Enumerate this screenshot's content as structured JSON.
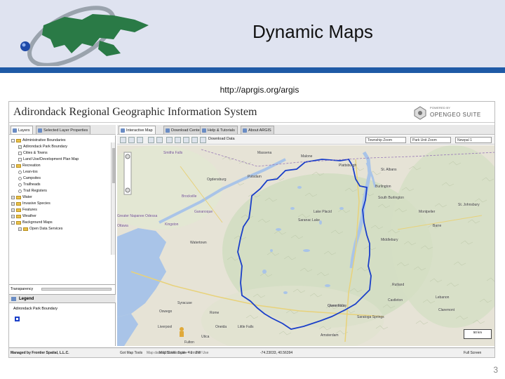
{
  "slide": {
    "title": "Dynamic Maps",
    "url": "http://aprgis.org/argis",
    "page_number": "3"
  },
  "app": {
    "title": "Adirondack Regional Geographic Information System",
    "brand_top": "POWERED BY",
    "brand_name": "OPENGEO SUITE"
  },
  "left_tabs": [
    {
      "label": "Layers",
      "active": true
    },
    {
      "label": "Selected Layer Properties",
      "active": false
    }
  ],
  "right_tabs": [
    {
      "label": "Interactive Map",
      "active": true
    },
    {
      "label": "Download Center",
      "active": false
    },
    {
      "label": "Help & Tutorials",
      "active": false
    },
    {
      "label": "About ARGIS",
      "active": false
    }
  ],
  "layer_tree": [
    {
      "label": "Administrative Boundaries",
      "type": "folder",
      "indent": 0,
      "expander": "-"
    },
    {
      "label": "Adirondack Park Boundary",
      "type": "checkbox",
      "checked": true,
      "indent": 1
    },
    {
      "label": "Cities & Towns",
      "type": "checkbox",
      "checked": false,
      "indent": 1
    },
    {
      "label": "Land Use/Development Plan Map",
      "type": "checkbox",
      "checked": false,
      "indent": 1
    },
    {
      "label": "Recreation",
      "type": "folder",
      "indent": 0,
      "expander": "-"
    },
    {
      "label": "Lean-tos",
      "type": "radio",
      "checked": false,
      "indent": 1
    },
    {
      "label": "Campsites",
      "type": "radio",
      "checked": false,
      "indent": 1
    },
    {
      "label": "Trailheads",
      "type": "radio",
      "checked": false,
      "indent": 1
    },
    {
      "label": "Trail Registers",
      "type": "radio",
      "checked": false,
      "indent": 1
    },
    {
      "label": "Water",
      "type": "folder",
      "indent": 0,
      "expander": "+"
    },
    {
      "label": "Invasive Species",
      "type": "folder",
      "indent": 0,
      "expander": "+"
    },
    {
      "label": "Features",
      "type": "folder",
      "indent": 0,
      "expander": "+"
    },
    {
      "label": "Weather",
      "type": "folder",
      "indent": 0,
      "expander": "+"
    },
    {
      "label": "Background Maps",
      "type": "folder",
      "indent": 0,
      "expander": "-"
    },
    {
      "label": "Open Data Services",
      "type": "folder",
      "indent": 1,
      "expander": "+"
    }
  ],
  "transparency_label": "Transparency",
  "legend": {
    "title": "Legend",
    "items": [
      {
        "label": "Adirondack Park Boundary",
        "color": "#1a3fc9"
      }
    ]
  },
  "toolbar": {
    "download_label": "Download Data",
    "select_townships": "Township Zoom",
    "select_park_unit": "Park Unit Zoom",
    "extra_select": "Newpal 1"
  },
  "map_labels": [
    {
      "text": "Smiths Falls",
      "kind": "ca"
    },
    {
      "text": "Ogdensburg",
      "kind": "us"
    },
    {
      "text": "Brockville",
      "kind": "ca"
    },
    {
      "text": "Potsdam",
      "kind": "us"
    },
    {
      "text": "Malone",
      "kind": "us"
    },
    {
      "text": "Massena",
      "kind": "us"
    },
    {
      "text": "Plattsburgh",
      "kind": "us"
    },
    {
      "text": "St. Albans",
      "kind": "us"
    },
    {
      "text": "Burlington",
      "kind": "us"
    },
    {
      "text": "South Burlington",
      "kind": "us"
    },
    {
      "text": "Saranac Lake",
      "kind": "us"
    },
    {
      "text": "Lake Placid",
      "kind": "us"
    },
    {
      "text": "Gananoque",
      "kind": "ca"
    },
    {
      "text": "Kingston",
      "kind": "ca"
    },
    {
      "text": "Odessa",
      "kind": "ca"
    },
    {
      "text": "Watertown",
      "kind": "us"
    },
    {
      "text": "Montpelier",
      "kind": "us"
    },
    {
      "text": "Barre",
      "kind": "us"
    },
    {
      "text": "Middlebury",
      "kind": "us"
    },
    {
      "text": "St. Johnsbury",
      "kind": "us"
    },
    {
      "text": "Rutland",
      "kind": "us"
    },
    {
      "text": "Castleton",
      "kind": "us"
    },
    {
      "text": "Glens Falls",
      "kind": "us"
    },
    {
      "text": "Queensbury",
      "kind": "us"
    },
    {
      "text": "Saratoga Springs",
      "kind": "us"
    },
    {
      "text": "Rome",
      "kind": "us"
    },
    {
      "text": "Oneida",
      "kind": "us"
    },
    {
      "text": "Utica",
      "kind": "us"
    },
    {
      "text": "Syracuse",
      "kind": "us"
    },
    {
      "text": "Liverpool",
      "kind": "us"
    },
    {
      "text": "Little Falls",
      "kind": "us"
    },
    {
      "text": "Amsterdam",
      "kind": "us"
    },
    {
      "text": "Lebanon",
      "kind": "us"
    },
    {
      "text": "Claremont",
      "kind": "us"
    },
    {
      "text": "Fulton",
      "kind": "us"
    },
    {
      "text": "Oswego",
      "kind": "us"
    },
    {
      "text": "Greater Napanee",
      "kind": "ca"
    },
    {
      "text": "Ottawa",
      "kind": "ca"
    }
  ],
  "map_scale_label": "50 km",
  "status": {
    "managed_by": "Managed by Frontier Spatial, L.L.C.",
    "map_data": "Map data ©2014 Google - Terms of Use",
    "map_tools": "Got Map Tools",
    "map_scale": "Map Scale: Scale = 1 : 2M",
    "coordinates": "-74.23033, 40.56394",
    "full_screen": "Full Screen"
  }
}
